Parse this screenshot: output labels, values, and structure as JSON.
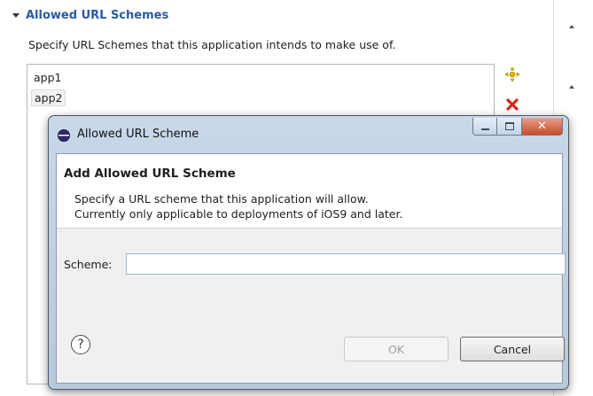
{
  "section": {
    "title": "Allowed URL Schemes",
    "description": "Specify URL Schemes that this application intends to make use of."
  },
  "schemes_list": {
    "items": [
      {
        "label": "app1",
        "selected": false
      },
      {
        "label": "app2",
        "selected": true
      }
    ]
  },
  "side_buttons": {
    "add_icon": "add-icon",
    "remove_icon": "remove-icon"
  },
  "dialog": {
    "window_title": "Allowed URL Scheme",
    "banner_title": "Add Allowed URL Scheme",
    "message_line1": "Specify a URL scheme that this application will allow.",
    "message_line2": "Currently only applicable to deployments of iOS9 and later.",
    "scheme_label": "Scheme:",
    "scheme_value": "",
    "help_label": "?",
    "ok_label": "OK",
    "cancel_label": "Cancel",
    "ok_enabled": false
  },
  "colors": {
    "section_title": "#2a5aa8",
    "close_button": "#c84b2c",
    "remove_icon": "#d8261b",
    "add_icon": "#e2b800"
  }
}
